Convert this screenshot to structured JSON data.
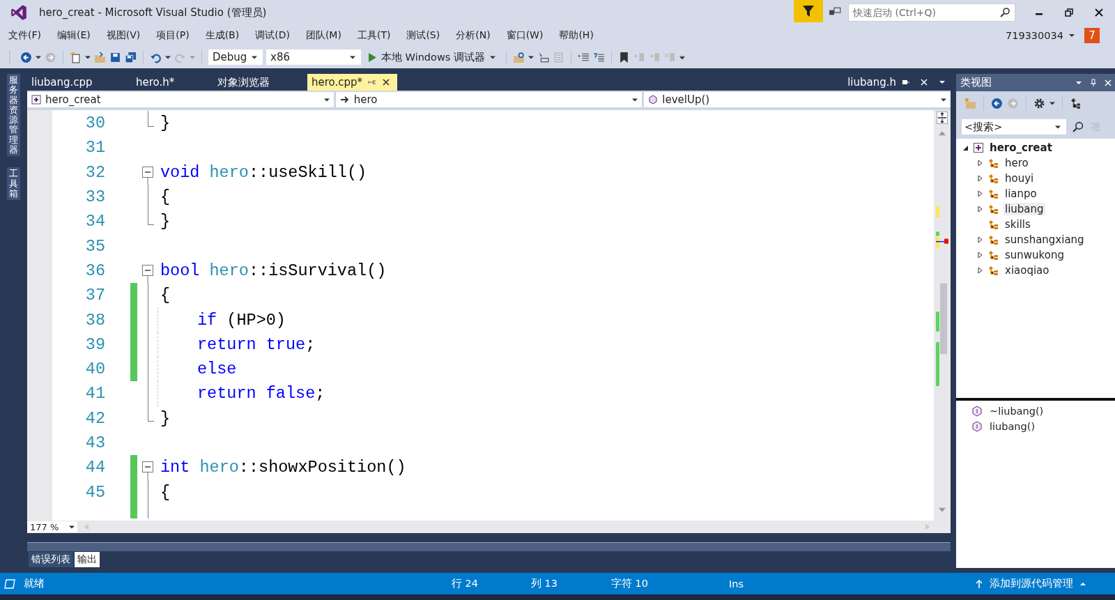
{
  "window": {
    "title": "hero_creat - Microsoft Visual Studio (管理员)",
    "quick_launch": {
      "placeholder": "快速启动 (Ctrl+Q)"
    },
    "user": "719330034",
    "notification_count": "7"
  },
  "menu": [
    "文件(F)",
    "编辑(E)",
    "视图(V)",
    "项目(P)",
    "生成(B)",
    "调试(D)",
    "团队(M)",
    "工具(T)",
    "测试(S)",
    "分析(N)",
    "窗口(W)",
    "帮助(H)"
  ],
  "toolbar": {
    "configuration": "Debug",
    "platform": "x86",
    "debugger": "本地 Windows 调试器"
  },
  "side_tabs": [
    "服务器资源管理器",
    "工具箱"
  ],
  "tabs": [
    {
      "label": "liubang.cpp",
      "selected": false
    },
    {
      "label": "hero.h*",
      "selected": false
    },
    {
      "label": "对象浏览器",
      "selected": false
    },
    {
      "label": "hero.cpp*",
      "selected": true
    }
  ],
  "preview_tab": {
    "label": "liubang.h"
  },
  "navigation": {
    "project": "hero_creat",
    "scope": "hero",
    "member": "levelUp()"
  },
  "editor": {
    "zoom": "177 %",
    "lines": [
      {
        "number": "30",
        "modified": false,
        "indented": false,
        "kind": "fold_end",
        "tokens": [
          {
            "kind": "plain",
            "text": "}"
          }
        ]
      },
      {
        "number": "31",
        "modified": false,
        "indented": false,
        "kind": "blank"
      },
      {
        "number": "32",
        "modified": false,
        "indented": false,
        "kind": "fold_start",
        "tokens": [
          {
            "kind": "keyword",
            "text": "void "
          },
          {
            "kind": "type",
            "text": "hero"
          },
          {
            "kind": "plain",
            "text": "::useSkill()"
          }
        ]
      },
      {
        "number": "33",
        "modified": false,
        "indented": false,
        "kind": "fold_body",
        "tokens": [
          {
            "kind": "plain",
            "text": "{"
          }
        ]
      },
      {
        "number": "34",
        "modified": false,
        "indented": false,
        "kind": "fold_end",
        "tokens": [
          {
            "kind": "plain",
            "text": "}"
          }
        ]
      },
      {
        "number": "35",
        "modified": false,
        "indented": false,
        "kind": "blank"
      },
      {
        "number": "36",
        "modified": false,
        "indented": false,
        "kind": "fold_start",
        "tokens": [
          {
            "kind": "keyword",
            "text": "bool "
          },
          {
            "kind": "type",
            "text": "hero"
          },
          {
            "kind": "plain",
            "text": "::isSurvival()"
          }
        ]
      },
      {
        "number": "37",
        "modified": true,
        "indented": false,
        "kind": "fold_body",
        "tokens": [
          {
            "kind": "plain",
            "text": "{"
          }
        ]
      },
      {
        "number": "38",
        "modified": true,
        "indented": true,
        "kind": "fold_body",
        "tokens": [
          {
            "kind": "keyword",
            "text": "if"
          },
          {
            "kind": "plain",
            "text": " (HP>0)"
          }
        ]
      },
      {
        "number": "39",
        "modified": true,
        "indented": true,
        "kind": "fold_body",
        "tokens": [
          {
            "kind": "keyword",
            "text": "return true"
          },
          {
            "kind": "plain",
            "text": ";"
          }
        ]
      },
      {
        "number": "40",
        "modified": true,
        "indented": true,
        "kind": "fold_body",
        "tokens": [
          {
            "kind": "keyword",
            "text": "else"
          }
        ]
      },
      {
        "number": "41",
        "modified": false,
        "indented": true,
        "kind": "fold_body",
        "tokens": [
          {
            "kind": "keyword",
            "text": "return false"
          },
          {
            "kind": "plain",
            "text": ";"
          }
        ]
      },
      {
        "number": "42",
        "modified": false,
        "indented": false,
        "kind": "fold_end",
        "tokens": [
          {
            "kind": "plain",
            "text": "}"
          }
        ]
      },
      {
        "number": "43",
        "modified": false,
        "indented": false,
        "kind": "blank"
      },
      {
        "number": "44",
        "modified": true,
        "indented": false,
        "kind": "fold_start",
        "tokens": [
          {
            "kind": "keyword",
            "text": "int "
          },
          {
            "kind": "type",
            "text": "hero"
          },
          {
            "kind": "plain",
            "text": "::showxPosition()"
          }
        ]
      },
      {
        "number": "45",
        "modified": true,
        "indented": false,
        "kind": "fold_body",
        "tokens": [
          {
            "kind": "plain",
            "text": "{"
          }
        ]
      }
    ]
  },
  "class_view": {
    "title": "类视图",
    "search": {
      "placeholder": "<搜索>"
    },
    "tree": {
      "label": "hero_creat",
      "expanded": true,
      "children": [
        {
          "label": "hero",
          "expandable": true,
          "selected": false
        },
        {
          "label": "houyi",
          "expandable": true,
          "selected": false
        },
        {
          "label": "lianpo",
          "expandable": true,
          "selected": false
        },
        {
          "label": "liubang",
          "expandable": true,
          "selected": true
        },
        {
          "label": "skills",
          "expandable": false,
          "selected": false
        },
        {
          "label": "sunshangxiang",
          "expandable": true,
          "selected": false
        },
        {
          "label": "sunwukong",
          "expandable": true,
          "selected": false
        },
        {
          "label": "xiaoqiao",
          "expandable": true,
          "selected": false
        }
      ]
    },
    "members": [
      "~liubang()",
      "liubang()"
    ]
  },
  "output_panel": {
    "tabs": [
      {
        "label": "错误列表",
        "selected": false
      },
      {
        "label": "输出",
        "selected": true
      }
    ]
  },
  "status_bar": {
    "state": "就绪",
    "line": "行 24",
    "column": "列 13",
    "char": "字符 10",
    "mode": "Ins",
    "source_control": "添加到源代码管理"
  }
}
